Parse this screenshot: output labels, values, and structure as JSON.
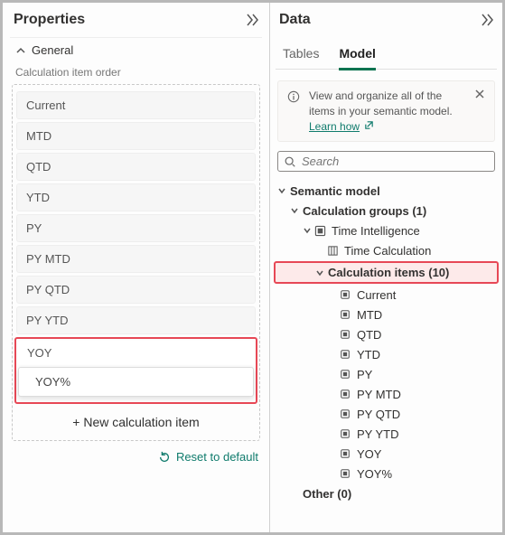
{
  "properties": {
    "title": "Properties",
    "section": "General",
    "order_label": "Calculation item order",
    "items": [
      "Current",
      "MTD",
      "QTD",
      "YTD",
      "PY",
      "PY MTD",
      "PY QTD",
      "PY YTD"
    ],
    "highlighted_item": "YOY",
    "editing_item": "YOY%",
    "new_item_label": "+ New calculation item",
    "reset_label": "Reset to default"
  },
  "data_panel": {
    "title": "Data",
    "tabs": {
      "tables": "Tables",
      "model": "Model"
    },
    "info_text": "View and organize all of the items in your semantic model. ",
    "info_link": "Learn how",
    "search_placeholder": "Search",
    "tree": {
      "root": "Semantic model",
      "calc_groups": "Calculation groups (1)",
      "time_intel": "Time Intelligence",
      "time_calc": "Time Calculation",
      "calc_items": "Calculation items (10)",
      "items": [
        "Current",
        "MTD",
        "QTD",
        "YTD",
        "PY",
        "PY MTD",
        "PY QTD",
        "PY YTD",
        "YOY",
        "YOY%"
      ],
      "other": "Other (0)"
    }
  }
}
